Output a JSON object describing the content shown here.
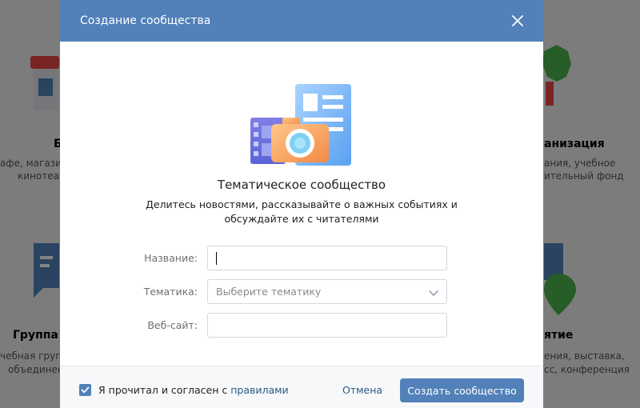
{
  "background": {
    "cards": [
      {
        "id": "business",
        "title": "Б",
        "lines": [
          "афе, магазин",
          "кинотеат"
        ]
      },
      {
        "id": "organization",
        "title": "анизация",
        "lines": [
          "ания, учебное",
          "ительный фонд"
        ]
      },
      {
        "id": "group",
        "title": "Группа п",
        "lines": [
          "чебная групп",
          "объединен"
        ]
      },
      {
        "id": "event",
        "title": "ятие",
        "lines": [
          "ения, выставка,",
          "сс, конференция"
        ]
      }
    ]
  },
  "modal": {
    "title": "Создание сообщества",
    "close_icon": "close-icon",
    "illustration_icon": "thematic-community-illustration",
    "heading": "Тематическое сообщество",
    "description": "Делитесь новостями, рассказывайте о важных событиях и обсуждайте их с читателями",
    "form": {
      "name_label": "Название:",
      "name_value": "",
      "topic_label": "Тематика:",
      "topic_placeholder": "Выберите тематику",
      "website_label": "Веб-сайт:",
      "website_value": ""
    },
    "footer": {
      "agree_prefix": "Я прочитал и согласен с ",
      "rules_link": "правилами",
      "agree_checked": true,
      "cancel_label": "Отмена",
      "create_label": "Создать сообщество"
    }
  },
  "colors": {
    "header": "#5181b8",
    "button": "#5181b8",
    "link": "#2a5885"
  }
}
